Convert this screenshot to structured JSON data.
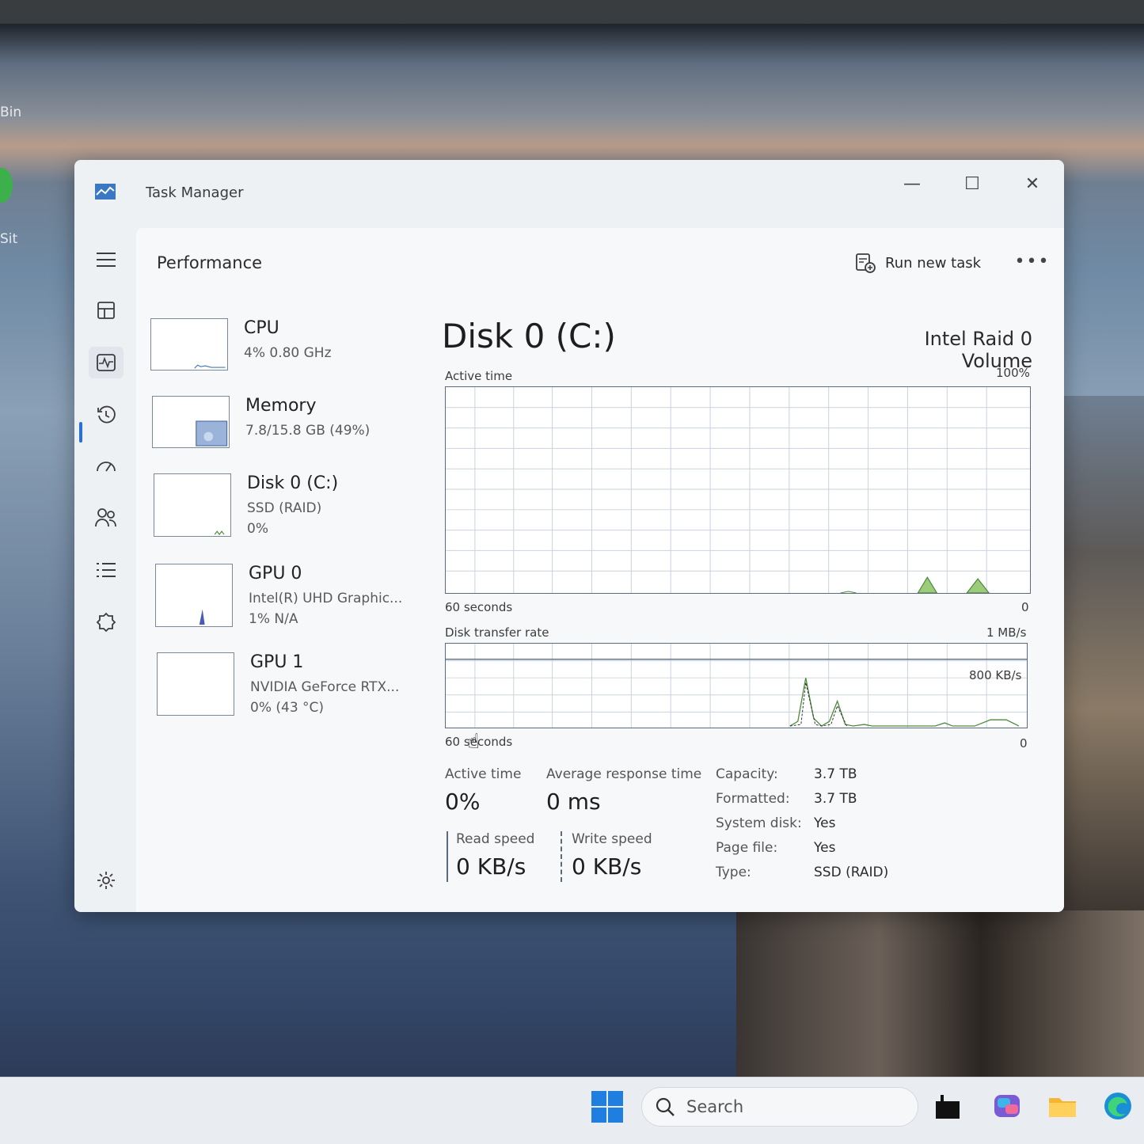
{
  "desktop": {
    "labels": [
      "Bin",
      "Sit"
    ]
  },
  "window": {
    "title": "Task Manager",
    "controls": {
      "minimize": "—",
      "maximize": "☐",
      "close": "✕"
    }
  },
  "nav": {
    "icons": [
      "hamburger-icon",
      "processes-icon",
      "performance-icon",
      "app-history-icon",
      "startup-apps-icon",
      "users-icon",
      "details-icon",
      "services-icon",
      "settings-icon"
    ]
  },
  "header": {
    "page_title": "Performance",
    "run_new_task": "Run new task",
    "more": "•••"
  },
  "resources": [
    {
      "name": "CPU",
      "sub": "4%  0.80 GHz",
      "sub2": ""
    },
    {
      "name": "Memory",
      "sub": "7.8/15.8 GB (49%)",
      "sub2": ""
    },
    {
      "name": "Disk 0 (C:)",
      "sub": "SSD (RAID)",
      "sub2": "0%"
    },
    {
      "name": "GPU 0",
      "sub": "Intel(R) UHD Graphic...",
      "sub2": "1%  N/A"
    },
    {
      "name": "GPU 1",
      "sub": "NVIDIA GeForce RTX...",
      "sub2": "0%  (43 °C)"
    }
  ],
  "disk": {
    "title": "Disk 0 (C:)",
    "model": "Intel Raid 0 Volume",
    "active_graph": {
      "label": "Active time",
      "max": "100%",
      "left": "60 seconds",
      "right": "0"
    },
    "transfer_graph": {
      "label": "Disk transfer rate",
      "max": "1 MB/s",
      "mid": "800 KB/s",
      "left": "60 seconds",
      "right": "0"
    },
    "stats": {
      "active_time_label": "Active time",
      "active_time_value": "0%",
      "avg_response_label": "Average response time",
      "avg_response_value": "0 ms",
      "read_label": "Read speed",
      "read_value": "0 KB/s",
      "write_label": "Write speed",
      "write_value": "0 KB/s"
    },
    "properties": [
      {
        "label": "Capacity:",
        "value": "3.7 TB"
      },
      {
        "label": "Formatted:",
        "value": "3.7 TB"
      },
      {
        "label": "System disk:",
        "value": "Yes"
      },
      {
        "label": "Page file:",
        "value": "Yes"
      },
      {
        "label": "Type:",
        "value": "SSD (RAID)"
      }
    ]
  },
  "taskbar": {
    "search_placeholder": "Search"
  },
  "colors": {
    "accent": "#2a6fd8",
    "disk_graph_line": "#4d8a3a",
    "memory_fill": "#6f8fc4"
  }
}
